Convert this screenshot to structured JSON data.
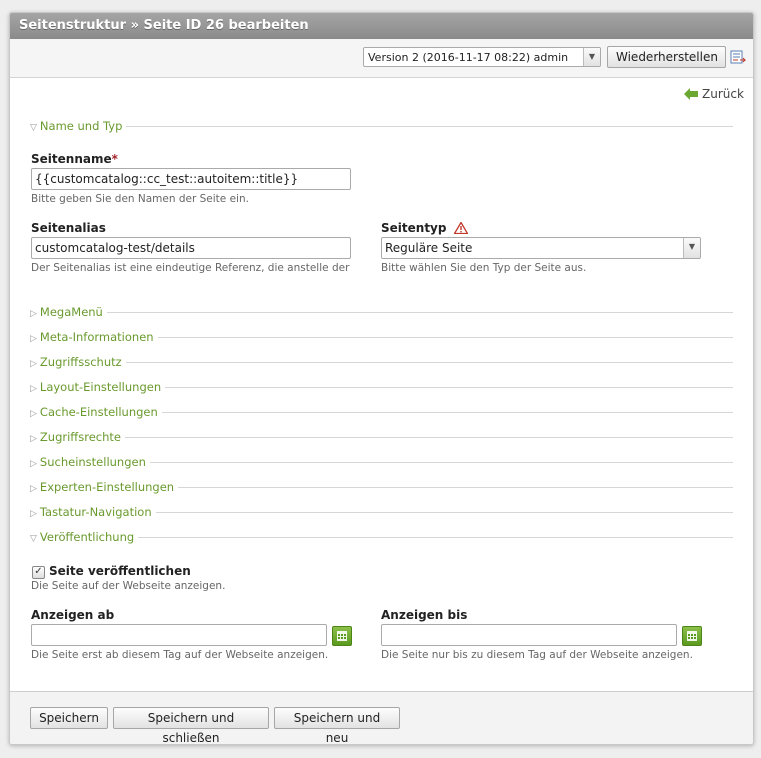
{
  "header": {
    "title": "Seitenstruktur » Seite ID 26 bearbeiten"
  },
  "version_bar": {
    "selected_version": "Version 2 (2016-11-17 08:22) admin",
    "restore_label": "Wiederherstellen"
  },
  "back_label": "Zurück",
  "sections": {
    "name_type": "Name und Typ",
    "collapsed": [
      "MegaMenü",
      "Meta-Informationen",
      "Zugriffsschutz",
      "Layout-Einstellungen",
      "Cache-Einstellungen",
      "Zugriffsrechte",
      "Sucheinstellungen",
      "Experten-Einstellungen",
      "Tastatur-Navigation"
    ],
    "publish": "Veröffentlichung"
  },
  "fields": {
    "page_name": {
      "label": "Seitenname",
      "required_mark": "*",
      "value": "{{customcatalog::cc_test::autoitem::title}}",
      "help": "Bitte geben Sie den Namen der Seite ein."
    },
    "page_alias": {
      "label": "Seitenalias",
      "value": "customcatalog-test/details",
      "help": "Der Seitenalias ist eine eindeutige Referenz, die anstelle der"
    },
    "page_type": {
      "label": "Seitentyp",
      "value": "Reguläre Seite",
      "help": "Bitte wählen Sie den Typ der Seite aus."
    },
    "publish": {
      "label": "Seite veröffentlichen",
      "checked": true,
      "help": "Die Seite auf der Webseite anzeigen."
    },
    "show_from": {
      "label": "Anzeigen ab",
      "value": "",
      "help": "Die Seite erst ab diesem Tag auf der Webseite anzeigen."
    },
    "show_until": {
      "label": "Anzeigen bis",
      "value": "",
      "help": "Die Seite nur bis zu diesem Tag auf der Webseite anzeigen."
    }
  },
  "footer": {
    "save": "Speichern",
    "save_close": "Speichern und schließen",
    "save_new": "Speichern und neu"
  },
  "colors": {
    "legend_green": "#6a9a2e",
    "required_red": "#a2232c",
    "titlebar_gray": "#999999"
  }
}
